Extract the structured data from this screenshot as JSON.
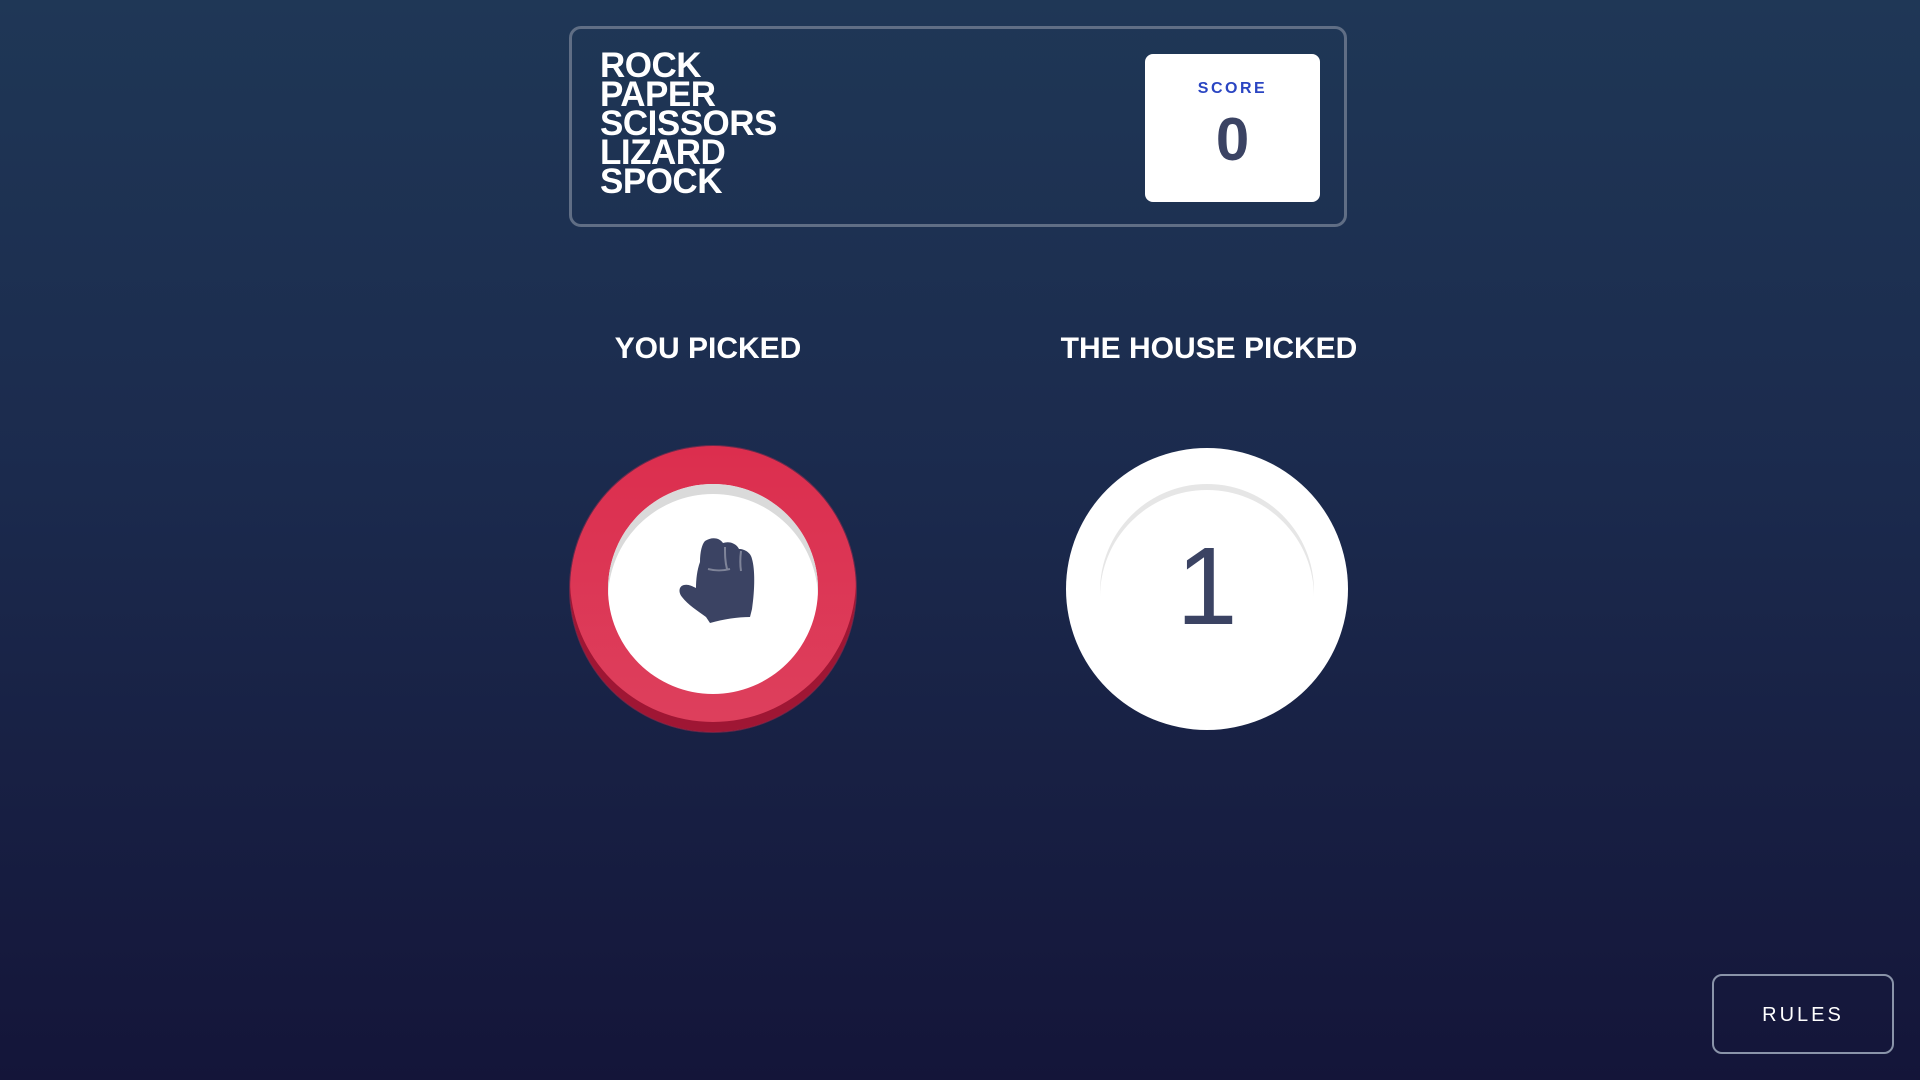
{
  "header": {
    "title_lines": [
      "ROCK",
      "PAPER",
      "SCISSORS",
      "LIZARD",
      "SPOCK"
    ],
    "score_label": "SCORE",
    "score_value": "0"
  },
  "game": {
    "player_heading": "YOU PICKED",
    "house_heading": "THE HOUSE PICKED",
    "player_pick": {
      "choice": "rock",
      "icon": "rock-fist-icon",
      "ring_color": "#dc2e4e",
      "ring_shadow_color": "#9f1634"
    },
    "house_pick": {
      "countdown": "1"
    }
  },
  "footer": {
    "rules_label": "RULES"
  },
  "colors": {
    "background_top": "#1f3756",
    "background_bottom": "#141539",
    "header_outline": "#606e85",
    "score_label": "#2a45c2",
    "dark_text": "#3b4363"
  }
}
